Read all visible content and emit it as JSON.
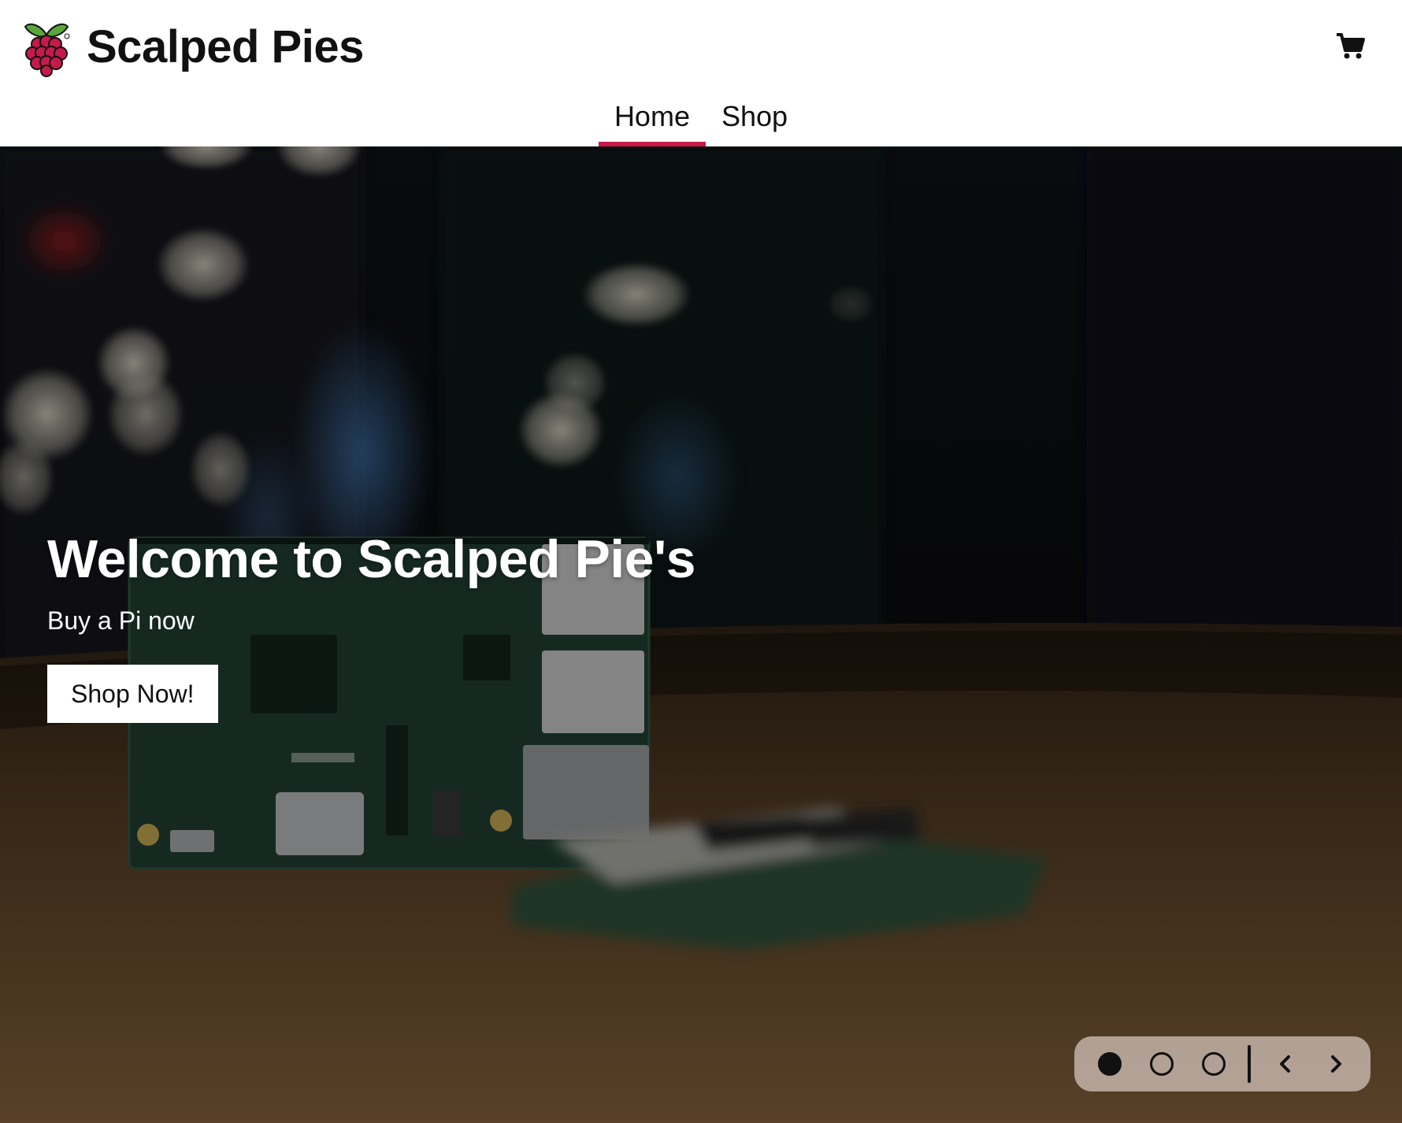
{
  "brand": {
    "name": "Scalped Pies",
    "logo_icon": "raspberry-logo-icon"
  },
  "header": {
    "cart_icon": "cart-icon"
  },
  "nav": {
    "items": [
      {
        "label": "Home",
        "active": true
      },
      {
        "label": "Shop",
        "active": false
      }
    ]
  },
  "hero": {
    "title": "Welcome to Scalped Pie's",
    "subtitle": "Buy a Pi now",
    "cta_label": "Shop Now!"
  },
  "carousel": {
    "slide_count": 3,
    "active_index": 0,
    "prev_icon": "chevron-left-icon",
    "next_icon": "chevron-right-icon"
  },
  "colors": {
    "accent": "#c51a4a",
    "text": "#111111",
    "control_bg": "#cdbeb4"
  }
}
